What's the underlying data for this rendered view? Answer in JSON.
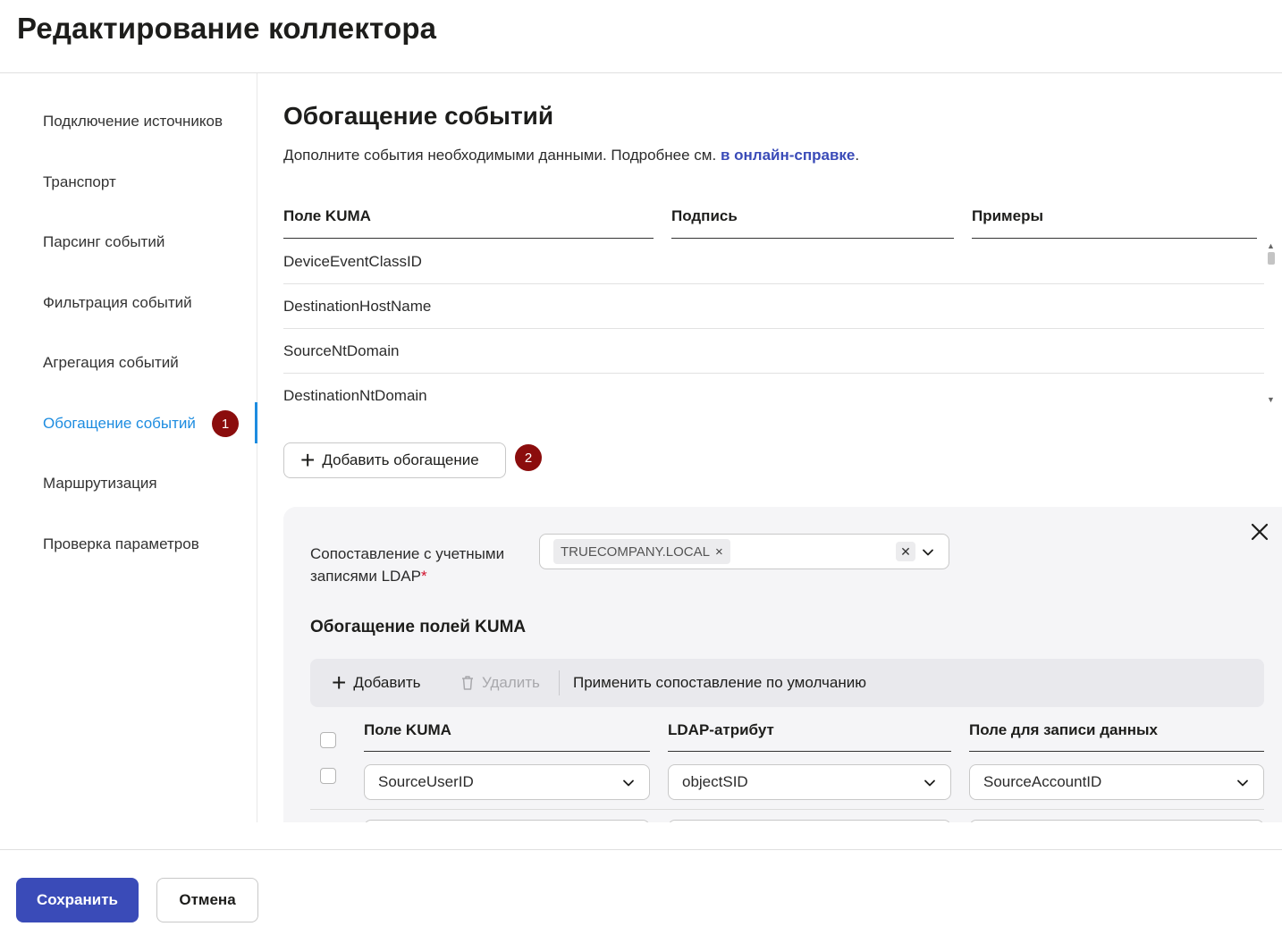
{
  "page": {
    "title": "Редактирование коллектора"
  },
  "sidebar": {
    "items": [
      {
        "label": "Подключение источников"
      },
      {
        "label": "Транспорт"
      },
      {
        "label": "Парсинг событий"
      },
      {
        "label": "Фильтрация событий"
      },
      {
        "label": "Агрегация событий"
      },
      {
        "label": "Обогащение событий",
        "active": true,
        "badge": "1"
      },
      {
        "label": "Маршрутизация"
      },
      {
        "label": "Проверка параметров"
      }
    ]
  },
  "section": {
    "title": "Обогащение событий",
    "desc_text": "Дополните события необходимыми данными. Подробнее см. ",
    "desc_link": "в онлайн-справке",
    "desc_end": "."
  },
  "fields_table": {
    "columns": [
      "Поле KUMA",
      "Подпись",
      "Примеры"
    ],
    "rows": [
      "DeviceEventClassID",
      "DestinationHostName",
      "SourceNtDomain",
      "DestinationNtDomain"
    ]
  },
  "add_enrichment": {
    "label": "Добавить обогащение",
    "badge": "2"
  },
  "enrichment_panel": {
    "ldap_label": "Сопоставление с учетными записями LDAP",
    "required_mark": "*",
    "ldap_selected": "TRUECOMPANY.LOCAL",
    "chip_remove": "×",
    "clear_icon": "✕",
    "subtitle": "Обогащение полей KUMA",
    "toolbar": {
      "add": "Добавить",
      "delete": "Удалить",
      "apply_default": "Применить сопоставление по умолчанию"
    },
    "mapping_columns": [
      "Поле KUMA",
      "LDAP-атрибут",
      "Поле для записи данных"
    ],
    "mapping_rows": [
      {
        "kuma_field": "SourceUserID",
        "ldap_attr": "objectSID",
        "target_field": "SourceAccountID"
      }
    ]
  },
  "footer": {
    "save": "Сохранить",
    "cancel": "Отмена"
  },
  "colors": {
    "accent": "#3a4bb8",
    "active_nav": "#1d8ce0",
    "badge": "#8b0d0d",
    "required": "#d0102b"
  }
}
